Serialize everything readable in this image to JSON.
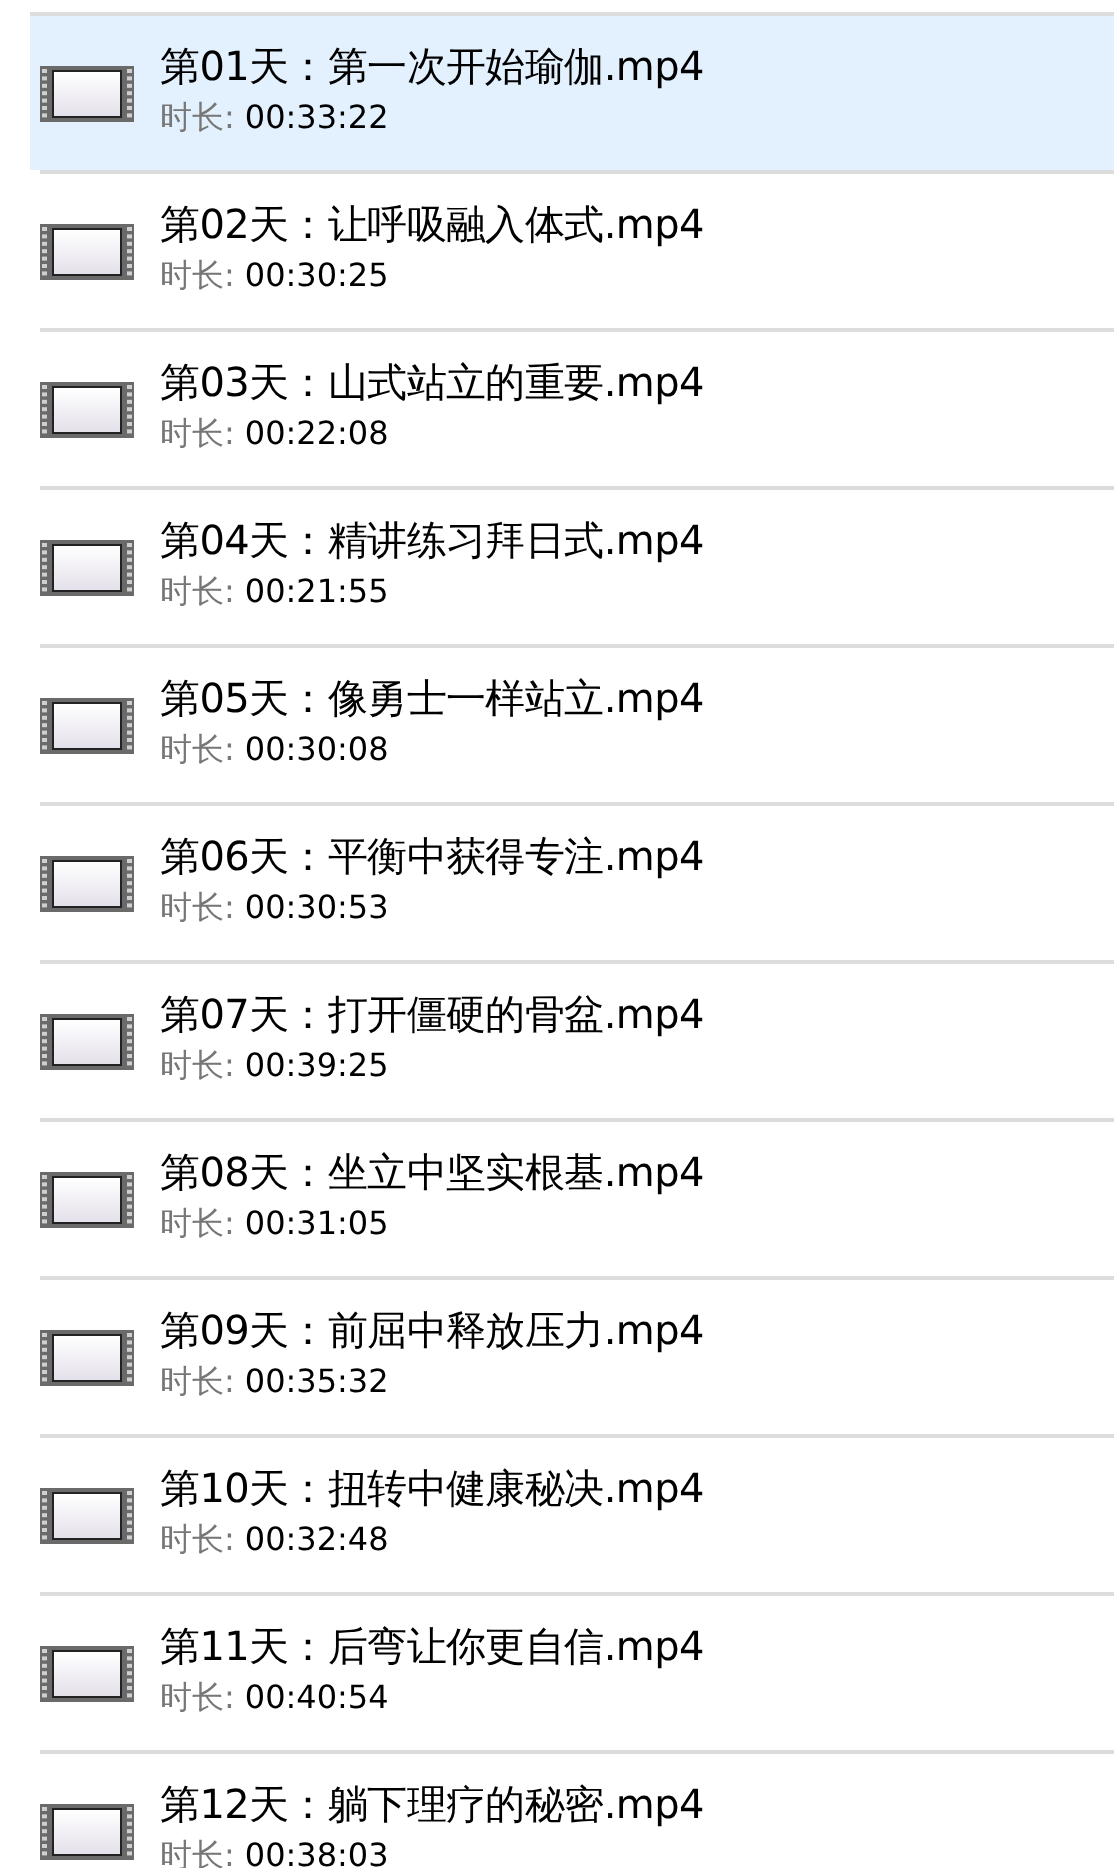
{
  "files": [
    {
      "name": "第01天：第一次开始瑜伽.mp4",
      "duration_label": "时长:",
      "duration": "00:33:22",
      "selected": true
    },
    {
      "name": "第02天：让呼吸融入体式.mp4",
      "duration_label": "时长:",
      "duration": "00:30:25",
      "selected": false
    },
    {
      "name": "第03天：山式站立的重要.mp4",
      "duration_label": "时长:",
      "duration": "00:22:08",
      "selected": false
    },
    {
      "name": "第04天：精讲练习拜日式.mp4",
      "duration_label": "时长:",
      "duration": "00:21:55",
      "selected": false
    },
    {
      "name": "第05天：像勇士一样站立.mp4",
      "duration_label": "时长:",
      "duration": "00:30:08",
      "selected": false
    },
    {
      "name": "第06天：平衡中获得专注.mp4",
      "duration_label": "时长:",
      "duration": "00:30:53",
      "selected": false
    },
    {
      "name": "第07天：打开僵硬的骨盆.mp4",
      "duration_label": "时长:",
      "duration": "00:39:25",
      "selected": false
    },
    {
      "name": "第08天：坐立中坚实根基.mp4",
      "duration_label": "时长:",
      "duration": "00:31:05",
      "selected": false
    },
    {
      "name": "第09天：前屈中释放压力.mp4",
      "duration_label": "时长:",
      "duration": "00:35:32",
      "selected": false
    },
    {
      "name": "第10天：扭转中健康秘决.mp4",
      "duration_label": "时长:",
      "duration": "00:32:48",
      "selected": false
    },
    {
      "name": "第11天：后弯让你更自信.mp4",
      "duration_label": "时长:",
      "duration": "00:40:54",
      "selected": false
    },
    {
      "name": "第12天：躺下理疗的秘密.mp4",
      "duration_label": "时长:",
      "duration": "00:38:03",
      "selected": false
    }
  ]
}
